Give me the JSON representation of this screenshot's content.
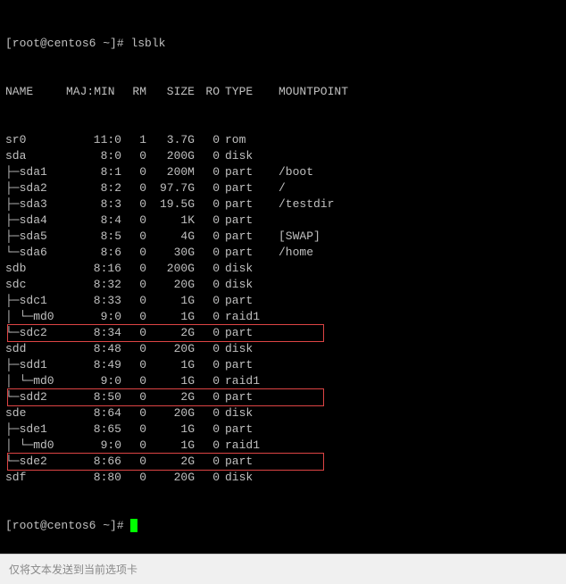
{
  "prompt1": "[root@centos6 ~]# ",
  "command": "lsblk",
  "prompt2": "[root@centos6 ~]# ",
  "headers": {
    "name": "NAME",
    "majmin": "MAJ:MIN",
    "rm": "RM",
    "size": "SIZE",
    "ro": "RO",
    "type": "TYPE",
    "mountpoint": "MOUNTPOINT"
  },
  "rows": [
    {
      "name": "sr0",
      "majmin": "11:0",
      "rm": "1",
      "size": "3.7G",
      "ro": "0",
      "type": "rom",
      "mp": "",
      "hl": false
    },
    {
      "name": "sda",
      "majmin": "8:0",
      "rm": "0",
      "size": "200G",
      "ro": "0",
      "type": "disk",
      "mp": "",
      "hl": false
    },
    {
      "name": "├─sda1",
      "majmin": "8:1",
      "rm": "0",
      "size": "200M",
      "ro": "0",
      "type": "part",
      "mp": "/boot",
      "hl": false
    },
    {
      "name": "├─sda2",
      "majmin": "8:2",
      "rm": "0",
      "size": "97.7G",
      "ro": "0",
      "type": "part",
      "mp": "/",
      "hl": false
    },
    {
      "name": "├─sda3",
      "majmin": "8:3",
      "rm": "0",
      "size": "19.5G",
      "ro": "0",
      "type": "part",
      "mp": "/testdir",
      "hl": false
    },
    {
      "name": "├─sda4",
      "majmin": "8:4",
      "rm": "0",
      "size": "1K",
      "ro": "0",
      "type": "part",
      "mp": "",
      "hl": false
    },
    {
      "name": "├─sda5",
      "majmin": "8:5",
      "rm": "0",
      "size": "4G",
      "ro": "0",
      "type": "part",
      "mp": "[SWAP]",
      "hl": false
    },
    {
      "name": "└─sda6",
      "majmin": "8:6",
      "rm": "0",
      "size": "30G",
      "ro": "0",
      "type": "part",
      "mp": "/home",
      "hl": false
    },
    {
      "name": "sdb",
      "majmin": "8:16",
      "rm": "0",
      "size": "200G",
      "ro": "0",
      "type": "disk",
      "mp": "",
      "hl": false
    },
    {
      "name": "sdc",
      "majmin": "8:32",
      "rm": "0",
      "size": "20G",
      "ro": "0",
      "type": "disk",
      "mp": "",
      "hl": false
    },
    {
      "name": "├─sdc1",
      "majmin": "8:33",
      "rm": "0",
      "size": "1G",
      "ro": "0",
      "type": "part",
      "mp": "",
      "hl": false
    },
    {
      "name": "│ └─md0",
      "majmin": "9:0",
      "rm": "0",
      "size": "1G",
      "ro": "0",
      "type": "raid1",
      "mp": "",
      "hl": false
    },
    {
      "name": "└─sdc2",
      "majmin": "8:34",
      "rm": "0",
      "size": "2G",
      "ro": "0",
      "type": "part",
      "mp": "",
      "hl": true
    },
    {
      "name": "sdd",
      "majmin": "8:48",
      "rm": "0",
      "size": "20G",
      "ro": "0",
      "type": "disk",
      "mp": "",
      "hl": false
    },
    {
      "name": "├─sdd1",
      "majmin": "8:49",
      "rm": "0",
      "size": "1G",
      "ro": "0",
      "type": "part",
      "mp": "",
      "hl": false
    },
    {
      "name": "│ └─md0",
      "majmin": "9:0",
      "rm": "0",
      "size": "1G",
      "ro": "0",
      "type": "raid1",
      "mp": "",
      "hl": false
    },
    {
      "name": "└─sdd2",
      "majmin": "8:50",
      "rm": "0",
      "size": "2G",
      "ro": "0",
      "type": "part",
      "mp": "",
      "hl": true
    },
    {
      "name": "sde",
      "majmin": "8:64",
      "rm": "0",
      "size": "20G",
      "ro": "0",
      "type": "disk",
      "mp": "",
      "hl": false
    },
    {
      "name": "├─sde1",
      "majmin": "8:65",
      "rm": "0",
      "size": "1G",
      "ro": "0",
      "type": "part",
      "mp": "",
      "hl": false
    },
    {
      "name": "│ └─md0",
      "majmin": "9:0",
      "rm": "0",
      "size": "1G",
      "ro": "0",
      "type": "raid1",
      "mp": "",
      "hl": false
    },
    {
      "name": "└─sde2",
      "majmin": "8:66",
      "rm": "0",
      "size": "2G",
      "ro": "0",
      "type": "part",
      "mp": "",
      "hl": true
    },
    {
      "name": "sdf",
      "majmin": "8:80",
      "rm": "0",
      "size": "20G",
      "ro": "0",
      "type": "disk",
      "mp": "",
      "hl": false
    }
  ],
  "statusbar": "仅将文本发送到当前选项卡"
}
